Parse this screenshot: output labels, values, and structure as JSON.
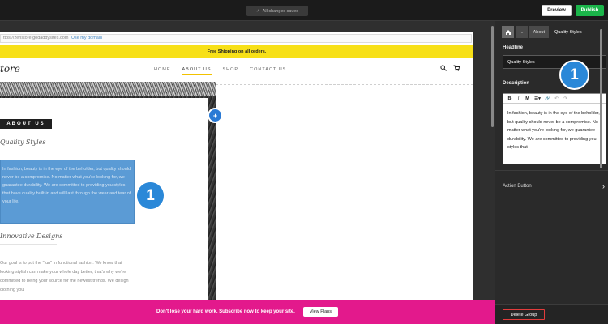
{
  "topbar": {
    "save_status": "All changes saved",
    "preview_label": "Preview",
    "publish_label": "Publish"
  },
  "browser": {
    "url": "ttps://zenstore.godaddysites.com",
    "domain_link": "Use my domain"
  },
  "site": {
    "announcement": "Free Shipping on all orders.",
    "logo": "tore",
    "nav": [
      "HOME",
      "ABOUT US",
      "SHOP",
      "CONTACT US"
    ],
    "active_nav": "ABOUT US",
    "section_label": "ABOUT US",
    "heading_1": "Quality Styles",
    "selected_text": "In fashion, beauty is in the eye of the beholder, but quality should never be a compromise. No matter what you're looking for, we guarantee durability. We are committed to providing you styles that have quality built-in and will last through the wear and tear of your life.",
    "heading_2": "Innovative Designs",
    "body_text": "Our goal is to put the \"fun\" in functional fashion. We know that looking stylish can make your whole day better, that's why we're committed to being your source for the newest trends. We design clothing you"
  },
  "badges": {
    "left": "1",
    "right": "1"
  },
  "add_button": "+",
  "promo": {
    "text": "Don't lose your hard work. Subscribe now to keep your site.",
    "button_label": "View Plans"
  },
  "panel": {
    "breadcrumbs": [
      "...",
      "About",
      "Quality Styles"
    ],
    "headline_label": "Headline",
    "headline_value": "Quality Styles",
    "description_label": "Description",
    "toolbar": [
      "B",
      "I",
      "M",
      "☰▾",
      "🔗",
      "↶",
      "↷"
    ],
    "description_value": "In fashion, beauty is in the eye of the beholder, but quality should never be a compromise. No matter what you're looking for, we guarantee durability. We are committed to providing you styles that",
    "action_button_label": "Action Button",
    "delete_label": "Delete Group"
  },
  "colors": {
    "publish": "#1bb54a",
    "promo": "#e3198c",
    "announcement": "#f7e017",
    "selection": "#5b9bd5",
    "badge": "#2a88d8"
  }
}
